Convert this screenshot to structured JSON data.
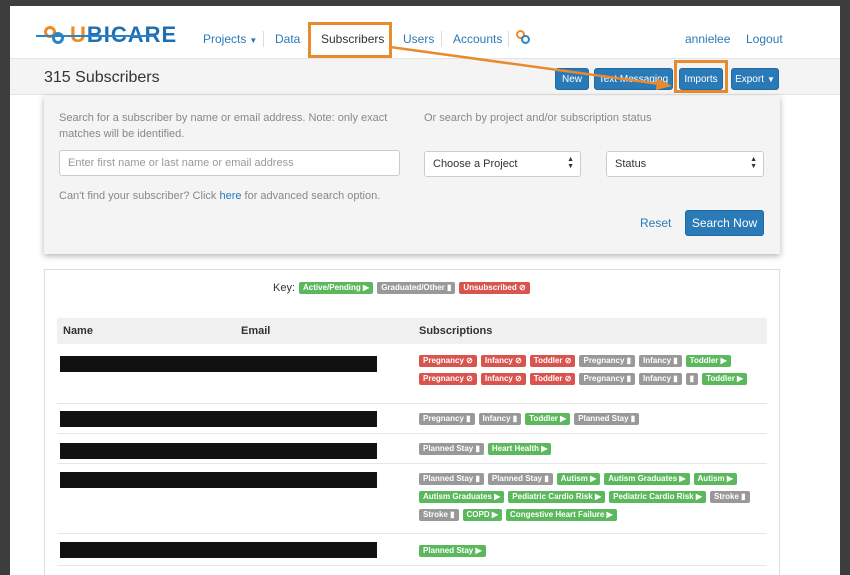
{
  "nav": {
    "logo_u": "U",
    "logo_rest": "BICARE",
    "projects": "Projects",
    "data": "Data",
    "subscribers": "Subscribers",
    "users": "Users",
    "accounts": "Accounts",
    "username": "annielee",
    "logout": "Logout"
  },
  "header": {
    "title": "315 Subscribers",
    "new_label": "New",
    "text_messaging_label": "Text Messaging",
    "imports_label": "Imports",
    "export_label": "Export"
  },
  "search": {
    "hint_name": "Search for a subscriber by name or email address. Note: only exact matches will be identified.",
    "hint_project": "Or search by project and/or subscription status",
    "name_placeholder": "Enter first name or last name or email address",
    "project_value": "Choose a Project",
    "status_value": "Status",
    "advanced_prefix": "Can't find your subscriber? Click ",
    "advanced_link": "here",
    "advanced_suffix": " for advanced search option.",
    "reset_label": "Reset",
    "search_now_label": "Search Now"
  },
  "key": {
    "label": "Key:",
    "active": "Active/Pending",
    "graduated": "Graduated/Other",
    "unsubscribed": "Unsubscribed"
  },
  "table": {
    "headers": [
      "Name",
      "Email",
      "Subscriptions"
    ],
    "rows": [
      {
        "subs": [
          {
            "t": "Pregnancy",
            "s": "red"
          },
          {
            "t": "Infancy",
            "s": "red"
          },
          {
            "t": "Toddler",
            "s": "red"
          },
          {
            "t": "Pregnancy",
            "s": "gray"
          },
          {
            "t": "Infancy",
            "s": "gray"
          },
          {
            "t": "Toddler",
            "s": "green"
          },
          {
            "t": "Pregnancy",
            "s": "red"
          },
          {
            "t": "Infancy",
            "s": "red"
          },
          {
            "t": "Toddler",
            "s": "red"
          },
          {
            "t": "Pregnancy",
            "s": "gray"
          },
          {
            "t": "Infancy",
            "s": "gray"
          },
          {
            "t": "",
            "s": "gray"
          },
          {
            "t": "Toddler",
            "s": "green"
          }
        ]
      },
      {
        "subs": [
          {
            "t": "Pregnancy",
            "s": "gray"
          },
          {
            "t": "Infancy",
            "s": "gray"
          },
          {
            "t": "Toddler",
            "s": "green"
          },
          {
            "t": "Planned Stay",
            "s": "gray"
          }
        ]
      },
      {
        "subs": [
          {
            "t": "Planned Stay",
            "s": "gray"
          },
          {
            "t": "Heart Health",
            "s": "green"
          }
        ]
      },
      {
        "subs": [
          {
            "t": "Planned Stay",
            "s": "gray"
          },
          {
            "t": "Planned Stay",
            "s": "gray"
          },
          {
            "t": "Autism",
            "s": "green"
          },
          {
            "t": "Autism Graduates",
            "s": "green"
          },
          {
            "t": "Autism",
            "s": "green"
          },
          {
            "t": "Autism Graduates",
            "s": "green"
          },
          {
            "t": "Pediatric Cardio Risk",
            "s": "green"
          },
          {
            "t": "Pediatric Cardio Risk",
            "s": "green"
          },
          {
            "t": "Stroke",
            "s": "gray"
          },
          {
            "t": "Stroke",
            "s": "gray"
          },
          {
            "t": "COPD",
            "s": "green"
          },
          {
            "t": "Congestive Heart Failure",
            "s": "green"
          }
        ]
      },
      {
        "subs": [
          {
            "t": "Planned Stay",
            "s": "green"
          }
        ]
      }
    ]
  },
  "colors": {
    "accent": "#2a7ab8",
    "highlight": "#e88b2e",
    "active": "#5cb85c",
    "graduated": "#999999",
    "unsubscribed": "#d9534f"
  },
  "icons": {
    "active": "play-icon",
    "graduated": "bookmark-icon",
    "unsubscribed": "ban-icon"
  }
}
